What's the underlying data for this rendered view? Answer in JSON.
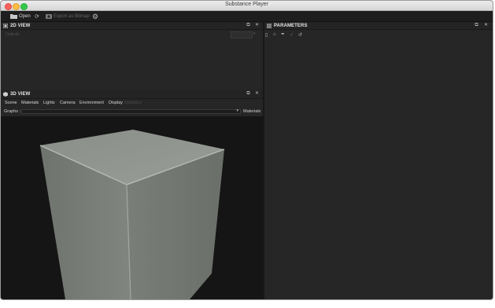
{
  "window": {
    "title": "Substance Player"
  },
  "toolbar": {
    "open_label": "Open",
    "export_label": "Export as Bitmap"
  },
  "panel2d": {
    "title": "2D VIEW",
    "outputs_label": "Outputs"
  },
  "panel3d": {
    "title": "3D VIEW",
    "menu": [
      "Scene",
      "Materials",
      "Lights",
      "Camera",
      "Environment",
      "Display",
      "Statistics"
    ],
    "graphs_label": "Graphs :",
    "materials_button": "Materials"
  },
  "parameters": {
    "title": "PARAMETERS"
  },
  "colors": {
    "background": "#2b2b2b",
    "viewport": "#151515",
    "cube_face_front": "#7d817b",
    "cube_face_top": "#8e928c",
    "cube_face_side": "#6f736d"
  }
}
